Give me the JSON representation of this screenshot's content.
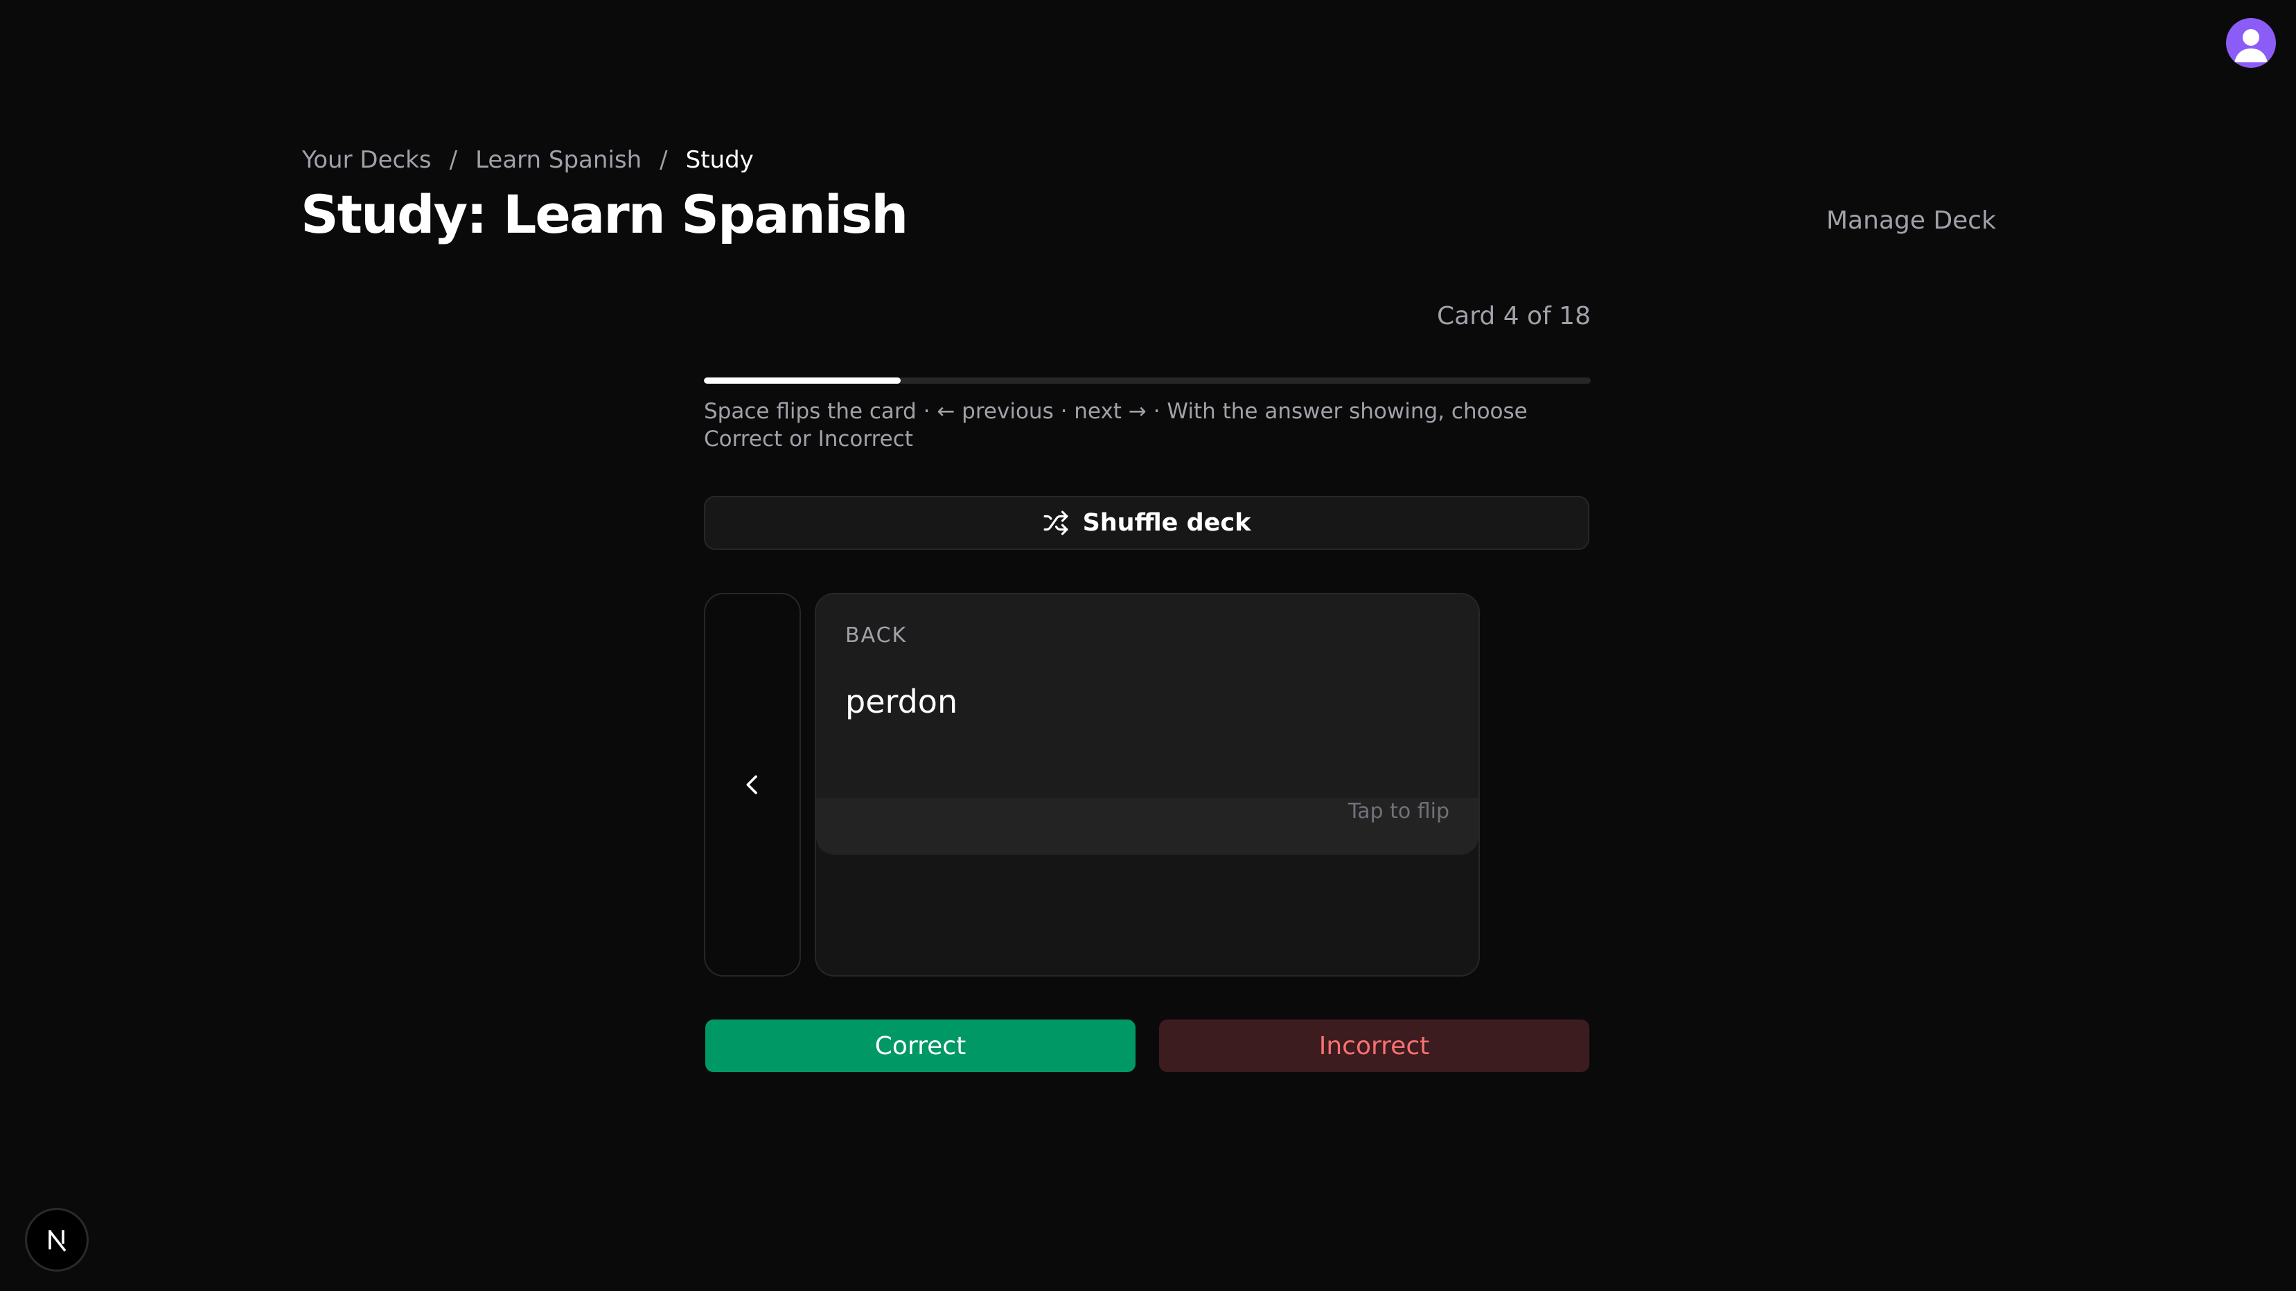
{
  "breadcrumb": {
    "items": [
      "Your Decks",
      "Learn Spanish"
    ],
    "separator": "/",
    "current": "Study"
  },
  "header": {
    "title": "Study: Learn Spanish",
    "manage_label": "Manage Deck"
  },
  "study": {
    "counter": "Card 4 of 18",
    "current_card": 4,
    "total_cards": 18,
    "progress_fraction": 0.222,
    "hint": "Space flips the card · ← previous · next → · With the answer showing, choose Correct or Incorrect",
    "shuffle_label": "Shuffle deck"
  },
  "card": {
    "side_label": "BACK",
    "text": "perdon",
    "flip_hint": "Tap to flip"
  },
  "actions": {
    "correct_label": "Correct",
    "incorrect_label": "Incorrect"
  },
  "icons": {
    "avatar": "user-avatar-icon",
    "shuffle": "shuffle-icon",
    "previous": "chevron-left-icon",
    "badge": "nextjs-logo-icon"
  },
  "colors": {
    "background": "#0a0a0a",
    "avatar": "#8b5cf6",
    "correct": "#009966",
    "incorrect_bg": "#3d1c1f",
    "incorrect_text": "#f87171"
  }
}
